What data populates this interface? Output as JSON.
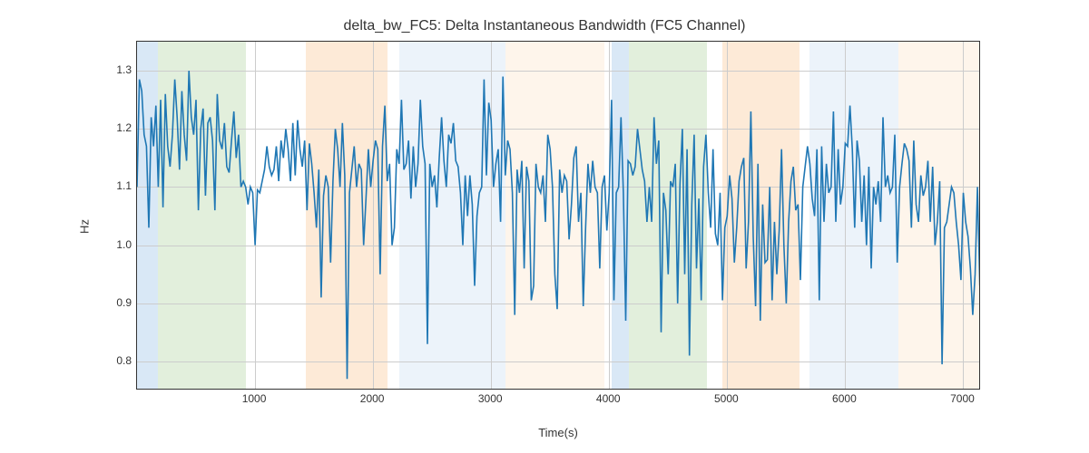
{
  "chart_data": {
    "type": "line",
    "title": "delta_bw_FC5: Delta Instantaneous Bandwidth (FC5 Channel)",
    "xlabel": "Time(s)",
    "ylabel": "Hz",
    "xlim": [
      0,
      7150
    ],
    "ylim": [
      0.75,
      1.35
    ],
    "xticks": [
      1000,
      2000,
      3000,
      4000,
      5000,
      6000,
      7000
    ],
    "yticks": [
      0.8,
      0.9,
      1.0,
      1.1,
      1.2,
      1.3
    ],
    "bands": [
      {
        "start": 0,
        "end": 180,
        "color": "#9fc5e8"
      },
      {
        "start": 180,
        "end": 920,
        "color": "#b6d7a8"
      },
      {
        "start": 1430,
        "end": 2120,
        "color": "#f9cb9c"
      },
      {
        "start": 2220,
        "end": 3000,
        "color": "#cfe2f3"
      },
      {
        "start": 3000,
        "end": 3120,
        "color": "#cfe2f3"
      },
      {
        "start": 3120,
        "end": 3960,
        "color": "#fce5cd"
      },
      {
        "start": 4020,
        "end": 4170,
        "color": "#9fc5e8"
      },
      {
        "start": 4170,
        "end": 4830,
        "color": "#b6d7a8"
      },
      {
        "start": 4960,
        "end": 5610,
        "color": "#f9cb9c"
      },
      {
        "start": 5700,
        "end": 6450,
        "color": "#cfe2f3"
      },
      {
        "start": 6450,
        "end": 7150,
        "color": "#fce5cd"
      }
    ],
    "series": [
      {
        "name": "delta_bw_FC5",
        "x_step": 20,
        "x_start": 0,
        "values": [
          1.1,
          1.285,
          1.265,
          1.19,
          1.17,
          1.03,
          1.22,
          1.17,
          1.24,
          1.1,
          1.25,
          1.065,
          1.26,
          1.17,
          1.135,
          1.19,
          1.285,
          1.22,
          1.13,
          1.265,
          1.19,
          1.145,
          1.3,
          1.22,
          1.19,
          1.25,
          1.06,
          1.2,
          1.235,
          1.085,
          1.21,
          1.22,
          1.18,
          1.06,
          1.26,
          1.18,
          1.165,
          1.21,
          1.135,
          1.125,
          1.18,
          1.23,
          1.15,
          1.19,
          1.1,
          1.11,
          1.1,
          1.07,
          1.1,
          1.09,
          1.0,
          1.095,
          1.09,
          1.11,
          1.13,
          1.17,
          1.135,
          1.12,
          1.13,
          1.17,
          1.11,
          1.18,
          1.15,
          1.2,
          1.165,
          1.11,
          1.21,
          1.12,
          1.215,
          1.165,
          1.135,
          1.18,
          1.06,
          1.175,
          1.14,
          1.09,
          1.03,
          1.13,
          0.91,
          1.085,
          1.12,
          1.1,
          0.97,
          1.11,
          1.2,
          1.165,
          1.1,
          1.21,
          1.12,
          0.77,
          1.09,
          1.13,
          1.17,
          1.1,
          1.14,
          1.13,
          1.0,
          1.08,
          1.165,
          1.1,
          1.145,
          1.18,
          1.165,
          0.95,
          1.17,
          1.24,
          1.11,
          1.14,
          1.0,
          1.03,
          1.165,
          1.14,
          1.25,
          1.13,
          1.14,
          1.18,
          1.08,
          1.17,
          1.1,
          1.14,
          1.25,
          1.17,
          1.14,
          0.83,
          1.14,
          1.1,
          1.12,
          1.065,
          1.15,
          1.22,
          1.145,
          1.1,
          1.19,
          1.175,
          1.21,
          1.145,
          1.135,
          1.09,
          1.0,
          1.12,
          1.05,
          1.12,
          1.07,
          0.93,
          1.05,
          1.09,
          1.1,
          1.285,
          1.12,
          1.245,
          1.215,
          1.1,
          1.14,
          1.165,
          1.04,
          1.29,
          1.12,
          1.18,
          1.165,
          1.09,
          0.88,
          1.13,
          1.09,
          1.145,
          0.96,
          1.135,
          1.11,
          0.905,
          0.93,
          1.14,
          1.1,
          1.09,
          1.12,
          1.04,
          1.19,
          1.165,
          1.1,
          0.95,
          0.89,
          1.13,
          1.09,
          1.12,
          1.11,
          1.01,
          1.07,
          1.15,
          1.17,
          1.04,
          1.09,
          0.895,
          1.03,
          1.14,
          1.09,
          1.145,
          1.1,
          1.09,
          0.96,
          1.1,
          1.12,
          1.025,
          1.09,
          1.25,
          0.905,
          1.09,
          1.1,
          1.22,
          1.09,
          0.87,
          1.145,
          1.14,
          1.12,
          1.135,
          1.2,
          1.165,
          1.13,
          1.11,
          1.04,
          1.1,
          1.04,
          1.22,
          1.14,
          1.18,
          0.85,
          1.09,
          1.06,
          0.95,
          1.11,
          1.1,
          1.14,
          0.9,
          1.105,
          1.2,
          0.95,
          1.165,
          0.81,
          1.07,
          1.19,
          0.96,
          1.08,
          0.905,
          1.135,
          1.19,
          1.09,
          1.03,
          1.165,
          1.02,
          1.0,
          1.09,
          0.905,
          1.03,
          1.05,
          1.12,
          1.08,
          0.97,
          1.03,
          1.11,
          1.135,
          1.15,
          0.96,
          1.04,
          1.23,
          1.015,
          0.895,
          1.14,
          0.87,
          1.07,
          0.97,
          0.975,
          1.1,
          0.905,
          1.04,
          0.95,
          1.025,
          1.165,
          1.0,
          0.9,
          1.04,
          1.11,
          1.135,
          1.06,
          1.07,
          0.94,
          1.1,
          1.135,
          1.17,
          1.14,
          1.08,
          1.05,
          1.165,
          0.905,
          1.17,
          1.04,
          1.14,
          1.09,
          1.1,
          1.23,
          1.04,
          1.165,
          1.07,
          1.1,
          1.175,
          1.17,
          1.24,
          1.165,
          1.03,
          1.18,
          1.145,
          1.04,
          1.12,
          1.0,
          1.135,
          0.96,
          1.1,
          1.07,
          1.11,
          1.04,
          1.22,
          1.1,
          1.12,
          1.09,
          1.1,
          1.19,
          0.97,
          1.1,
          1.14,
          1.175,
          1.165,
          1.145,
          1.03,
          1.18,
          1.07,
          1.04,
          1.12,
          1.085,
          1.1,
          1.145,
          1.04,
          1.135,
          1.0,
          1.04,
          1.11,
          0.795,
          1.03,
          1.04,
          1.07,
          1.1,
          1.09,
          1.04,
          1.0,
          0.94,
          1.09,
          1.04,
          1.015,
          0.96,
          0.88,
          0.95,
          1.1,
          0.93
        ]
      }
    ]
  }
}
